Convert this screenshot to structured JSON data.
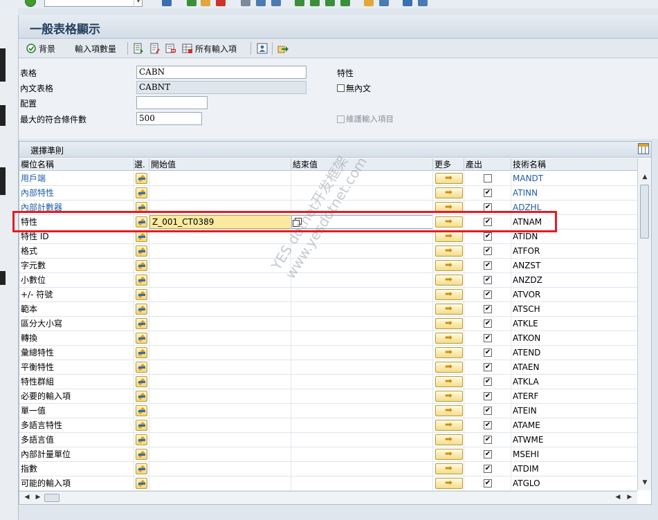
{
  "window": {
    "title": "一般表格顯示"
  },
  "toolbar": {
    "background_label": "背景",
    "entries_label": "輸入項數量",
    "all_entries_label": "所有輸入項"
  },
  "form": {
    "table_label": "表格",
    "table_value": "CABN",
    "text_table_label": "內文表格",
    "text_table_value": "CABNT",
    "layout_label": "配置",
    "layout_value": "",
    "max_hits_label": "最大的符合條件數",
    "max_hits_value": "500",
    "characteristic_label": "特性",
    "no_text_label": "無內文",
    "maintain_entries_label": "維護輸入項目"
  },
  "grid": {
    "caption": "選擇準則",
    "headers": {
      "field_name": "欄位名稱",
      "select": "選.",
      "from": "開始值",
      "to": "結束值",
      "more": "更多",
      "output": "產出",
      "tech_name": "技術名稱"
    },
    "rows": [
      {
        "name": "用戶端",
        "tech": "MANDT",
        "output": false,
        "from": "",
        "link": true
      },
      {
        "name": "內部特性",
        "tech": "ATINN",
        "output": true,
        "from": "",
        "link": true
      },
      {
        "name": "內部計數器",
        "tech": "ADZHL",
        "output": true,
        "from": "",
        "link": true
      },
      {
        "name": "特性",
        "tech": "ATNAM",
        "output": true,
        "from": "Z_001_CT0389",
        "link": false
      },
      {
        "name": "特性 ID",
        "tech": "ATIDN",
        "output": true,
        "from": "",
        "link": false
      },
      {
        "name": "格式",
        "tech": "ATFOR",
        "output": true,
        "from": "",
        "link": false
      },
      {
        "name": "字元數",
        "tech": "ANZST",
        "output": true,
        "from": "",
        "link": false
      },
      {
        "name": "小數位",
        "tech": "ANZDZ",
        "output": true,
        "from": "",
        "link": false
      },
      {
        "name": "+/- 符號",
        "tech": "ATVOR",
        "output": true,
        "from": "",
        "link": false
      },
      {
        "name": "範本",
        "tech": "ATSCH",
        "output": true,
        "from": "",
        "link": false
      },
      {
        "name": "區分大小寫",
        "tech": "ATKLE",
        "output": true,
        "from": "",
        "link": false
      },
      {
        "name": "轉換",
        "tech": "ATKON",
        "output": true,
        "from": "",
        "link": false
      },
      {
        "name": "彙總特性",
        "tech": "ATEND",
        "output": true,
        "from": "",
        "link": false
      },
      {
        "name": "平衡特性",
        "tech": "ATAEN",
        "output": true,
        "from": "",
        "link": false
      },
      {
        "name": "特性群組",
        "tech": "ATKLA",
        "output": true,
        "from": "",
        "link": false
      },
      {
        "name": "必要的輸入項",
        "tech": "ATERF",
        "output": true,
        "from": "",
        "link": false
      },
      {
        "name": "單一值",
        "tech": "ATEIN",
        "output": true,
        "from": "",
        "link": false
      },
      {
        "name": "多語言特性",
        "tech": "ATAME",
        "output": true,
        "from": "",
        "link": false
      },
      {
        "name": "多語言值",
        "tech": "ATWME",
        "output": true,
        "from": "",
        "link": false
      },
      {
        "name": "內部計量單位",
        "tech": "MSEHI",
        "output": true,
        "from": "",
        "link": false
      },
      {
        "name": "指數",
        "tech": "ATDIM",
        "output": true,
        "from": "",
        "link": false
      },
      {
        "name": "可能的輸入項",
        "tech": "ATGLO",
        "output": true,
        "from": "",
        "link": false
      }
    ]
  },
  "watermark": {
    "line1": "YES dotnet开发框架",
    "line2": "www.yesdotnet.com"
  },
  "colors": {
    "highlight": "#e41b23",
    "link": "#1f5da6",
    "title": "#26415f"
  }
}
